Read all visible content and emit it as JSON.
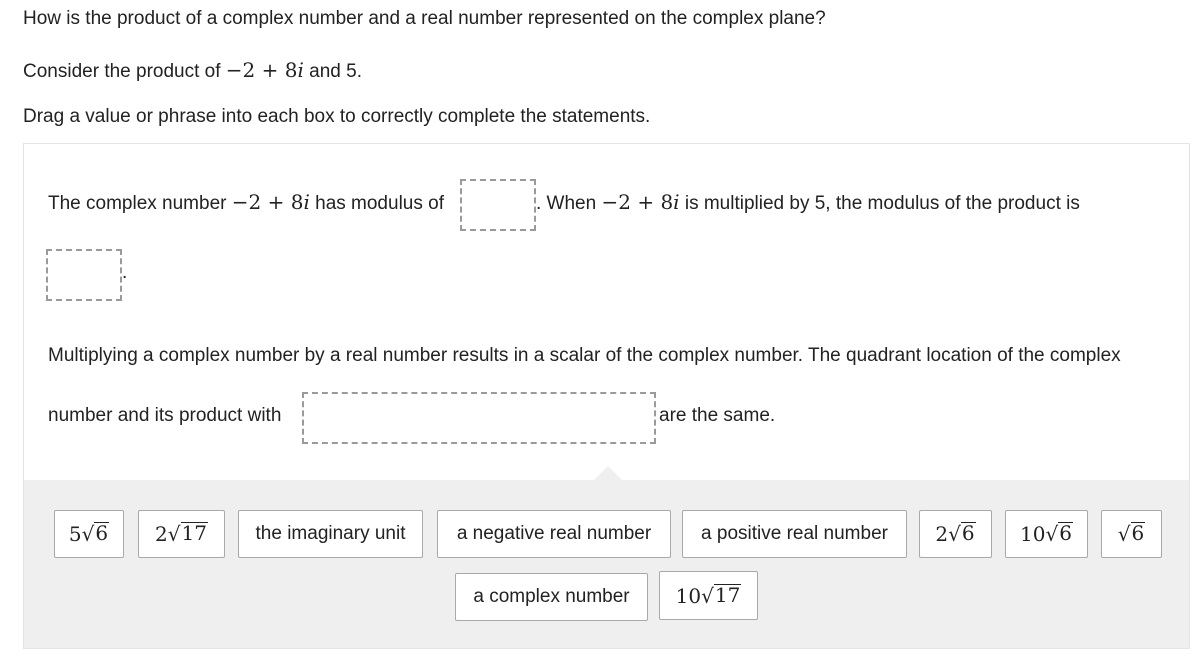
{
  "question": {
    "prompt": "How is the product of a complex number and a real number represented on the complex plane?",
    "consider_prefix": "Consider the product of",
    "consider_math": "−2 + 8i",
    "consider_suffix": "and 5.",
    "instructions": "Drag a value or phrase into each box to correctly complete the statements."
  },
  "statements": {
    "s1_a": "The complex number",
    "s1_math": "−2 + 8i",
    "s1_b": "has modulus of",
    "s1_c": ". When",
    "s1_math2": "−2 + 8i",
    "s1_d": "is multiplied by 5, the modulus of the product is",
    "s1_end": ".",
    "s2_a": "Multiplying a complex number by a real number results in a scalar of the complex number. The quadrant location of the complex",
    "s2_b": "number and its product with",
    "s2_c": "are the same."
  },
  "drop_zones": [
    {
      "id": "modulus-original",
      "value": ""
    },
    {
      "id": "modulus-product",
      "value": ""
    },
    {
      "id": "quadrant-phrase",
      "value": ""
    }
  ],
  "tiles": [
    {
      "coef": "5",
      "radicand": "6",
      "type": "math"
    },
    {
      "coef": "2",
      "radicand": "17",
      "type": "math"
    },
    {
      "label": "the imaginary unit",
      "type": "text"
    },
    {
      "label": "a negative real number",
      "type": "text"
    },
    {
      "label": "a positive real number",
      "type": "text"
    },
    {
      "coef": "2",
      "radicand": "6",
      "type": "math"
    },
    {
      "coef": "10",
      "radicand": "6",
      "type": "math"
    },
    {
      "coef": "",
      "radicand": "6",
      "type": "math"
    },
    {
      "label": "a complex number",
      "type": "text"
    },
    {
      "coef": "10",
      "radicand": "17",
      "type": "math"
    }
  ],
  "radical_symbol": "√"
}
